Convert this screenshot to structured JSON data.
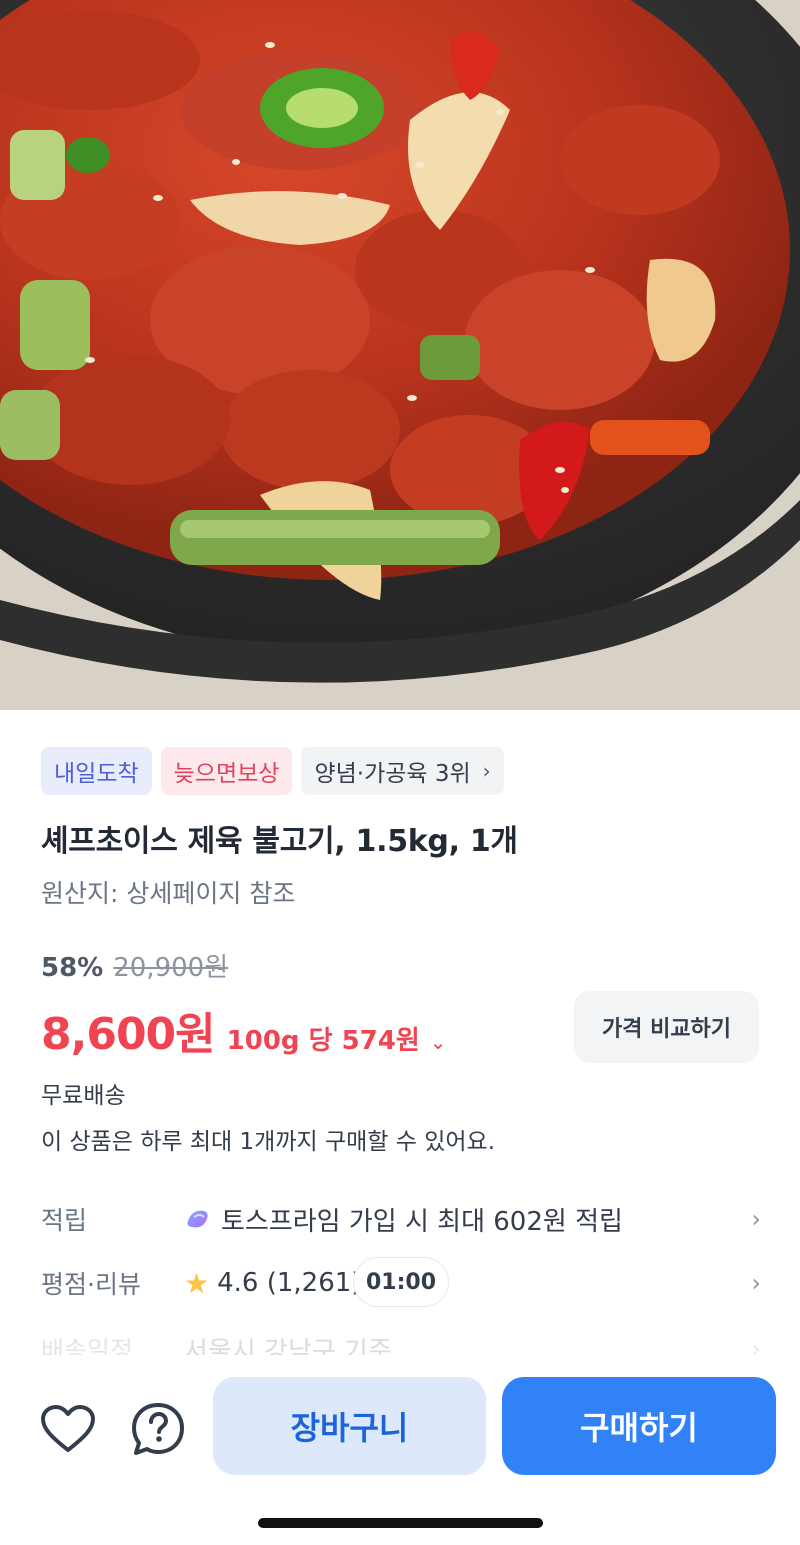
{
  "product_image": {
    "subject": "jeyuk-bulgogi-photo"
  },
  "badges": [
    {
      "label": "내일도착"
    },
    {
      "label": "늦으면보상"
    },
    {
      "label": "양념·가공육 3위"
    }
  ],
  "product": {
    "title": "셰프초이스 제육 불고기, 1.5kg, 1개",
    "origin": "원산지: 상세페이지 참조"
  },
  "pricing": {
    "discount_rate": "58%",
    "original_price": "20,900원",
    "sale_price": "8,600원",
    "unit_price": "100g 당 574원",
    "compare_button": "가격 비교하기"
  },
  "shipping": {
    "free_shipping": "무료배송",
    "purchase_limit": "이 상품은 하루 최대 1개까지 구매할 수 있어요."
  },
  "info": {
    "points_label": "적립",
    "points_value": "토스프라임 가입 시 최대 602원 적립",
    "rating_label": "평점·리뷰",
    "rating_value": "4.6 (1,261)",
    "delivery_label": "배송일정",
    "delivery_value": "서울시 강남구 기준"
  },
  "timer": {
    "value": "01:00"
  },
  "bottom_bar": {
    "cart_label": "장바구니",
    "buy_label": "구매하기"
  },
  "colors": {
    "accent_blue": "#3182f6",
    "price_red": "#f04452",
    "star_yellow": "#ffc342"
  }
}
